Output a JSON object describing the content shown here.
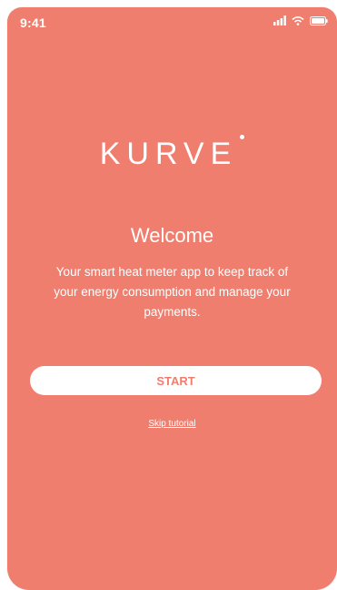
{
  "status_bar": {
    "time": "9:41",
    "icons": [
      "signal-icon",
      "wifi-icon",
      "battery-icon"
    ]
  },
  "branding": {
    "logo_text": "KURVE"
  },
  "welcome": {
    "title": "Welcome",
    "description": "Your smart heat meter app to keep track of your energy consumption and manage your payments."
  },
  "actions": {
    "start_label": "START",
    "skip_label": "Skip tutorial"
  },
  "colors": {
    "background": "#f07e6e",
    "text": "#ffffff",
    "button_bg": "#ffffff",
    "button_text": "#f07e6e"
  }
}
